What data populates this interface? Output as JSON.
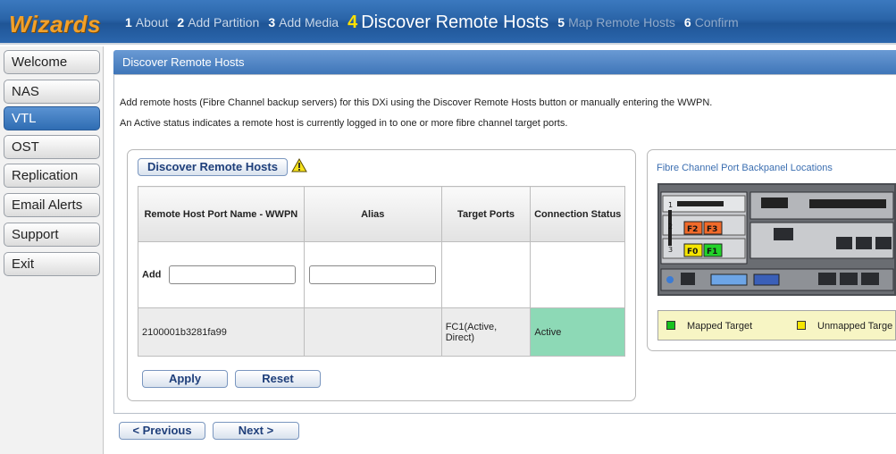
{
  "wizard": {
    "title": "Wizards",
    "steps": [
      {
        "num": "1",
        "label": "About"
      },
      {
        "num": "2",
        "label": "Add Partition"
      },
      {
        "num": "3",
        "label": "Add Media"
      },
      {
        "num": "4",
        "label": "Discover Remote Hosts"
      },
      {
        "num": "5",
        "label": "Map Remote Hosts"
      },
      {
        "num": "6",
        "label": "Confirm"
      }
    ]
  },
  "sidebar": {
    "items": [
      {
        "label": "Welcome"
      },
      {
        "label": "NAS"
      },
      {
        "label": "VTL"
      },
      {
        "label": "OST"
      },
      {
        "label": "Replication"
      },
      {
        "label": "Email Alerts"
      },
      {
        "label": "Support"
      },
      {
        "label": "Exit"
      }
    ]
  },
  "panel": {
    "title": "Discover Remote Hosts",
    "info_line1": "Add remote hosts (Fibre Channel backup servers) for this DXi using the Discover Remote Hosts button or manually entering the WWPN.",
    "info_line2": "An Active status indicates a remote host is currently logged in to one or more fibre channel target ports."
  },
  "discover_button": "Discover Remote Hosts",
  "table": {
    "headers": [
      "Remote Host Port Name - WWPN",
      "Alias",
      "Target Ports",
      "Connection Status"
    ],
    "add_label": "Add",
    "wwpn_input_value": "",
    "alias_input_value": "",
    "rows": [
      {
        "wwpn": "2100001b3281fa99",
        "alias": "",
        "target_ports": "FC1(Active, Direct)",
        "status": "Active"
      }
    ]
  },
  "actions": {
    "apply": "Apply",
    "reset": "Reset"
  },
  "nav": {
    "previous": "< Previous",
    "next": "Next >"
  },
  "fc": {
    "title": "Fibre Channel Port Backpanel Locations",
    "slot_labels": [
      "1",
      "2",
      "3"
    ],
    "port_labels": [
      "F2",
      "F3",
      "F0",
      "F1"
    ],
    "legend_mapped": "Mapped Target",
    "legend_unmapped": "Unmapped Targe",
    "mapped_color": "#17c21e",
    "unmapped_color": "#f5e500"
  }
}
